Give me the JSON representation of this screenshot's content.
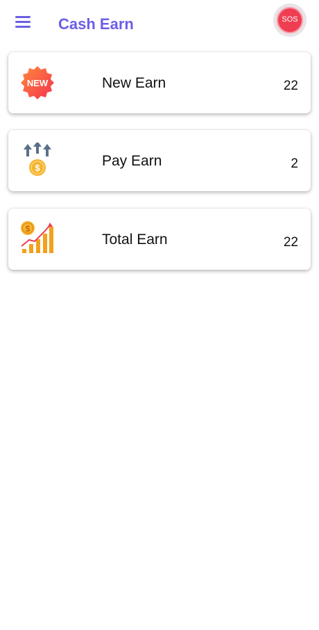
{
  "header": {
    "title": "Cash Earn",
    "sos_label": "SOS",
    "accent_color": "#6b5ee6",
    "sos_color": "#ef3e52"
  },
  "cards": [
    {
      "icon": "new-badge-icon",
      "label": "New Earn",
      "value": "22",
      "icon_text": "NEW"
    },
    {
      "icon": "pay-upload-coin-icon",
      "label": "Pay Earn",
      "value": "2"
    },
    {
      "icon": "growth-chart-coin-icon",
      "label": "Total Earn",
      "value": "22"
    }
  ]
}
